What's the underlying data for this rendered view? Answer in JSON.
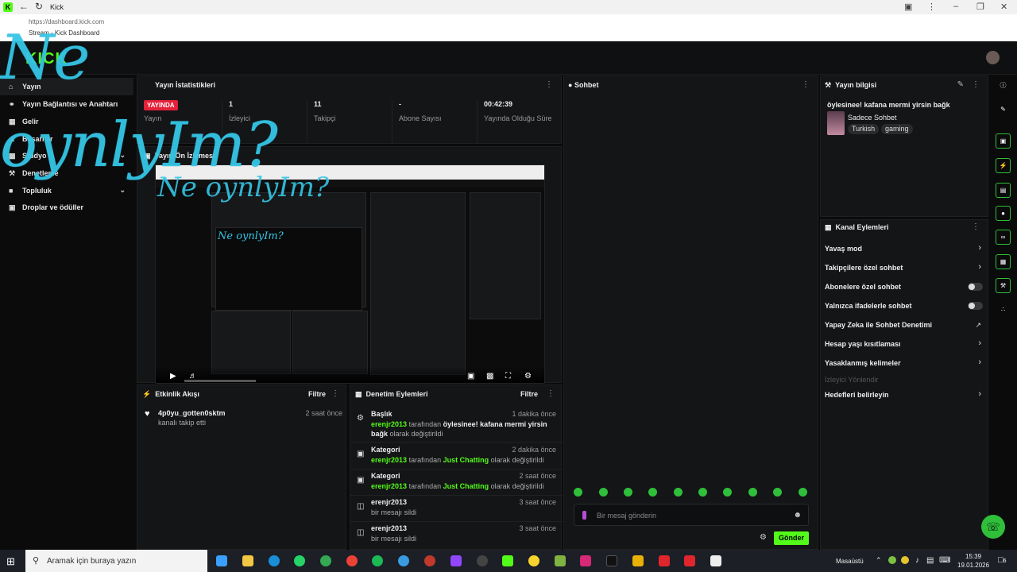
{
  "browser": {
    "tab_title": "Kick",
    "url": "https://dashboard.kick.com",
    "page_label": "Stream - Kick Dashboard"
  },
  "overlay": {
    "text": "Ne oynlyIm?",
    "mini_text": "Ne oynlyIm?",
    "tiny_text": "Ne oynlyIm?"
  },
  "header": {
    "logo": "KICK"
  },
  "sidebar": {
    "items": [
      {
        "label": "Yayın",
        "icon": "home-icon"
      },
      {
        "label": "Yayın Bağlantısı ve Anahtarı",
        "icon": "link-icon"
      },
      {
        "label": "Gelir",
        "icon": "money-icon"
      },
      {
        "label": "Başarılar",
        "icon": "trophy-icon"
      },
      {
        "label": "Stüdyo",
        "icon": "studio-icon"
      },
      {
        "label": "Denetleme",
        "icon": "wrench-icon"
      },
      {
        "label": "Topluluk",
        "icon": "community-icon"
      },
      {
        "label": "Droplar ve ödüller",
        "icon": "gift-icon"
      }
    ]
  },
  "stats": {
    "title": "Yayın İstatistikleri",
    "live_badge": "YAYINDA",
    "items": [
      {
        "value": "",
        "label": "Yayın"
      },
      {
        "value": "1",
        "label": "İzleyici"
      },
      {
        "value": "11",
        "label": "Takipçi"
      },
      {
        "value": "-",
        "label": "Abone Sayısı"
      },
      {
        "value": "00:42:39",
        "label": "Yayında Olduğu Süre"
      }
    ]
  },
  "preview": {
    "title": "Yayın Ön İzlemesi"
  },
  "activity": {
    "title": "Etkinlik Akışı",
    "filter": "Filtre",
    "items": [
      {
        "user": "4p0yu_gotten0sktm",
        "action": "kanalı takip etti",
        "time": "2 saat önce"
      }
    ]
  },
  "mod": {
    "title": "Denetim Eylemleri",
    "filter": "Filtre",
    "items": [
      {
        "title": "Başlık",
        "time": "1 dakika önce",
        "user": "erenjr2013",
        "by": "tarafından",
        "value": "öylesinee! kafana mermi yirsin bağk",
        "rest": "olarak değiştirildi"
      },
      {
        "title": "Kategori",
        "time": "2 dakika önce",
        "user": "erenjr2013",
        "by": "tarafından",
        "value": "Just Chatting",
        "rest": "olarak değiştirildi"
      },
      {
        "title": "Kategori",
        "time": "2 saat önce",
        "user": "erenjr2013",
        "by": "tarafından",
        "value": "Just Chatting",
        "rest": "olarak değiştirildi"
      },
      {
        "title": "erenjr2013",
        "time": "3 saat önce",
        "desc": "bir mesajı sildi"
      },
      {
        "title": "erenjr2013",
        "time": "3 saat önce",
        "desc": "bir mesajı sildi"
      }
    ]
  },
  "chat": {
    "title": "Sohbet",
    "placeholder": "Bir mesaj gönderin",
    "send": "Gönder"
  },
  "info": {
    "title": "Yayın bilgisi",
    "stream_title": "öylesinee! kafana mermi yirsin bağk",
    "category": "Sadece Sohbet",
    "tags": [
      "Turkish",
      "gaming"
    ]
  },
  "channel": {
    "title": "Kanal Eylemleri",
    "rows": [
      {
        "label": "Yavaş mod",
        "kind": "chevron"
      },
      {
        "label": "Takipçilere özel sohbet",
        "kind": "chevron"
      },
      {
        "label": "Abonelere özel sohbet",
        "kind": "toggle"
      },
      {
        "label": "Yalnızca ifadelerle sohbet",
        "kind": "toggle"
      },
      {
        "label": "Yapay Zeka ile Sohbet Denetimi",
        "kind": "external"
      },
      {
        "label": "Hesap yaşı kısıtlaması",
        "kind": "chevron"
      },
      {
        "label": "Yasaklanmış kelimeler",
        "kind": "chevron"
      }
    ],
    "section": "İzleyici Yönlendir",
    "last": "Hedefleri belirleyin"
  },
  "taskbar": {
    "search": "Aramak için buraya yazın",
    "desktop": "Masaüstü",
    "time": "15:39",
    "date": "19.01.2026",
    "notif_count": "6"
  },
  "colors": {
    "accent": "#53fc18",
    "live": "#e5213a",
    "overlay": "#35c6e6"
  }
}
